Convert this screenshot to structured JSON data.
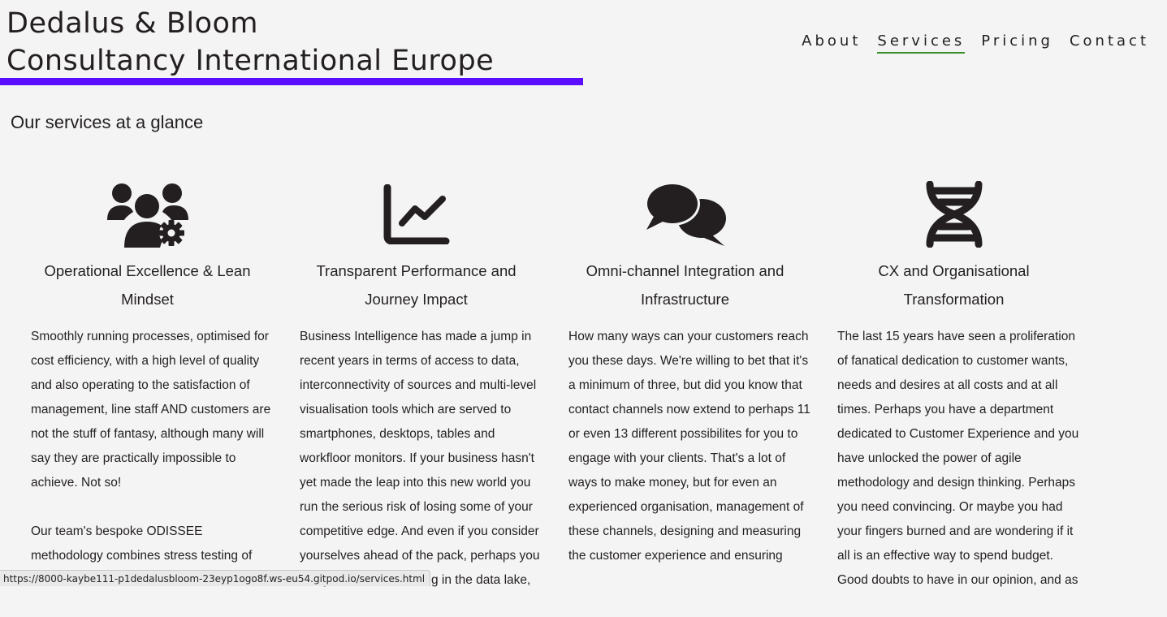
{
  "header": {
    "brand_line1": "Dedalus & Bloom",
    "brand_line2": "Consultancy International Europe",
    "accent_color": "#5a0dff"
  },
  "nav": {
    "items": [
      "About",
      "Services",
      "Pricing",
      "Contact"
    ],
    "active": "Services",
    "active_underline_color": "#3a8f2a"
  },
  "main": {
    "title": "Our services at a glance",
    "services": [
      {
        "icon": "users-gear-icon",
        "title": "Operational Excellence & Lean Mindset",
        "body": [
          "Smoothly running processes, optimised for cost efficiency, with a high level of quality and also operating to the satisfaction of management, line staff AND customers are not the stuff of fantasy, although many will say they are practically impossible to achieve. Not so!",
          "Our team's bespoke ODISSEE methodology combines stress testing of"
        ]
      },
      {
        "icon": "chart-line-icon",
        "title": "Transparent Performance and Journey Impact",
        "body": [
          "Business Intelligence has made a jump in recent years in terms of access to data, interconnectivity of sources and multi-level visualisation tools which are served to smartphones, desktops, tables and workfloor monitors. If your business hasn't yet made the leap into this new world you run the serious risk of losing some of your competitive edge. And even if you consider yourselves ahead of the pack, perhaps you find yourselves drowning in the data lake,"
        ]
      },
      {
        "icon": "comments-icon",
        "title": "Omni-channel Integration and Infrastructure",
        "body": [
          "How many ways can your customers reach you these days. We're willing to bet that it's a minimum of three, but did you know that contact channels now extend to perhaps 11 or even 13 different possibilites for you to engage with your clients. That's a lot of ways to make money, but for even an experienced organisation, management of these channels, designing and measuring the customer experience and ensuring"
        ]
      },
      {
        "icon": "dna-icon",
        "title": "CX and Organisational Transformation",
        "body": [
          "The last 15 years have seen a proliferation of fanatical dedication to customer wants, needs and desires at all costs and at all times. Perhaps you have a department dedicated to Customer Experience and you have unlocked the power of agile methodology and design thinking. Perhaps you need convincing. Or maybe you had your fingers burned and are wondering if it all is an effective way to spend budget. Good doubts to have in our opinion, and as"
        ]
      }
    ]
  },
  "status_bar": {
    "url": "https://8000-kaybe111-p1dedalusbloom-23eyp1ogo8f.ws-eu54.gitpod.io/services.html"
  }
}
